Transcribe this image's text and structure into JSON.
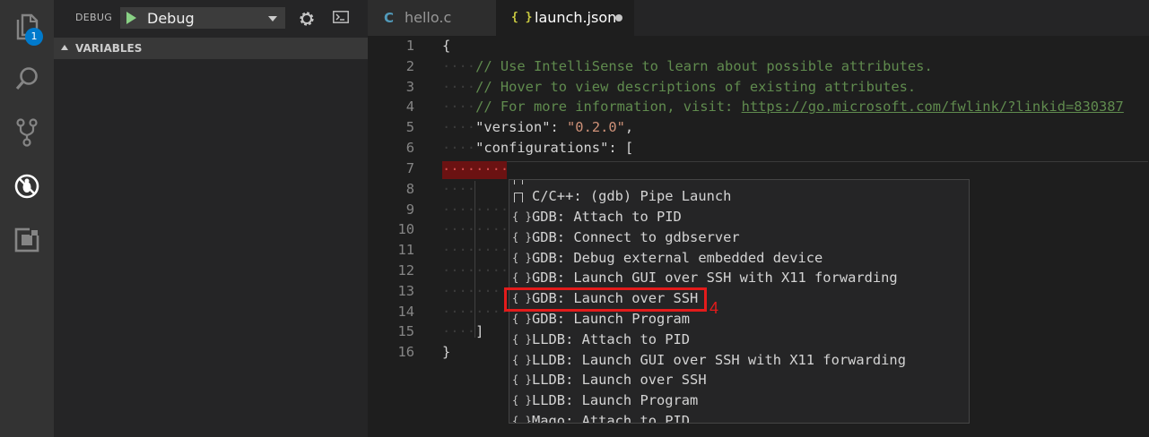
{
  "activity_bar": {
    "explorer_badge": "1",
    "icons": [
      "files-icon",
      "search-icon",
      "source-control-icon",
      "debug-icon",
      "extensions-icon"
    ]
  },
  "sidebar": {
    "title": "DEBUG",
    "config_selected": "Debug",
    "section_title": "VARIABLES"
  },
  "tabs": [
    {
      "label": "hello.c",
      "icon": "C"
    },
    {
      "label": "launch.json",
      "icon": "{ }"
    }
  ],
  "editor": {
    "line_numbers": [
      "1",
      "2",
      "3",
      "4",
      "5",
      "6",
      "7",
      "8",
      "9",
      "10",
      "11",
      "12",
      "13",
      "14",
      "15",
      "16"
    ],
    "lines": {
      "l1": "{",
      "l2_comment": "// Use IntelliSense to learn about possible attributes.",
      "l3_comment": "// Hover to view descriptions of existing attributes.",
      "l4_comment": "// For more information, visit: ",
      "l4_link": "https://go.microsoft.com/fwlink/?linkid=830387",
      "l5_key": "\"version\"",
      "l5_sep": ": ",
      "l5_val": "\"0.2.0\"",
      "l5_end": ",",
      "l6_key": "\"configurations\"",
      "l6_rest": ": [",
      "l15": "]",
      "l16": "}"
    }
  },
  "suggestions": [
    {
      "label": "C/C++: (gdb) Pipe Launch",
      "icon": "box"
    },
    {
      "label": "GDB: Attach to PID",
      "icon": "{}"
    },
    {
      "label": "GDB: Connect to gdbserver",
      "icon": "{}"
    },
    {
      "label": "GDB: Debug external embedded device",
      "icon": "{}"
    },
    {
      "label": "GDB: Launch GUI over SSH with X11 forwarding",
      "icon": "{}"
    },
    {
      "label": "GDB: Launch over SSH",
      "icon": "{}"
    },
    {
      "label": "GDB: Launch Program",
      "icon": "{}"
    },
    {
      "label": "LLDB: Attach to PID",
      "icon": "{}"
    },
    {
      "label": "LLDB: Launch GUI over SSH with X11 forwarding",
      "icon": "{}"
    },
    {
      "label": "LLDB: Launch over SSH",
      "icon": "{}"
    },
    {
      "label": "LLDB: Launch Program",
      "icon": "{}"
    },
    {
      "label": "Mago: Attach to PID",
      "icon": "{}"
    }
  ],
  "annotation": {
    "label": "4",
    "color": "#e31b1b"
  },
  "colors": {
    "accent": "#007acc",
    "play": "#89d185",
    "comment": "#608b4e",
    "string": "#ce9178"
  }
}
